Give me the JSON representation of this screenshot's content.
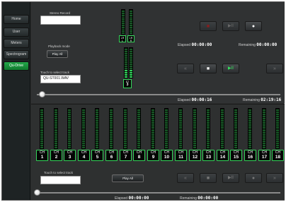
{
  "sidebar": {
    "items": [
      {
        "label": "Home",
        "active": false
      },
      {
        "label": "User",
        "active": false
      },
      {
        "label": "Meters",
        "active": false
      },
      {
        "label": "Spectrogram",
        "active": false
      },
      {
        "label": "Qu-Drive",
        "active": true
      }
    ]
  },
  "stereo": {
    "record_label": "Stereo Record",
    "record_value": "",
    "playback_mode_label": "Playback mode",
    "play_all_label": "Play All",
    "touch_label": "Touch to select track",
    "track_value": "QU-ST001.WAV",
    "elapsed_label": "Elapsed",
    "elapsed_value": "00:00:00",
    "remaining_label": "Remaining",
    "remaining_value": "00:00:00",
    "position_elapsed": "00:00:16",
    "position_remaining": "02:19:16",
    "position_fraction": 0.02,
    "lr_left": "LR",
    "lr_right": "LR",
    "lr_left_side": "L",
    "lr_right_side": "R",
    "st_label": "ST",
    "st_number": "3"
  },
  "multitrack": {
    "touch_label": "Touch to select track",
    "track_value": "",
    "play_all_label": "Play All",
    "elapsed_label": "Elapsed",
    "elapsed_value": "00:00:00",
    "remaining_label": "Remaining",
    "remaining_value": "00:00:00",
    "position_fraction": 0.0,
    "channel_prefix": "CH",
    "channels": [
      "1",
      "2",
      "3",
      "4",
      "5",
      "6",
      "7",
      "8",
      "9",
      "10",
      "11",
      "12",
      "13",
      "14",
      "15",
      "16",
      "17",
      "18"
    ]
  },
  "icons": {
    "rewind": "«",
    "stop": "■",
    "play_pause": "▶II",
    "record": "●",
    "fast_forward": "»"
  },
  "colors": {
    "active_green": "#1fa845",
    "record_red": "#8a1d1d",
    "meter_green": "#2fd25a",
    "meter_dark_green": "#155a25"
  }
}
